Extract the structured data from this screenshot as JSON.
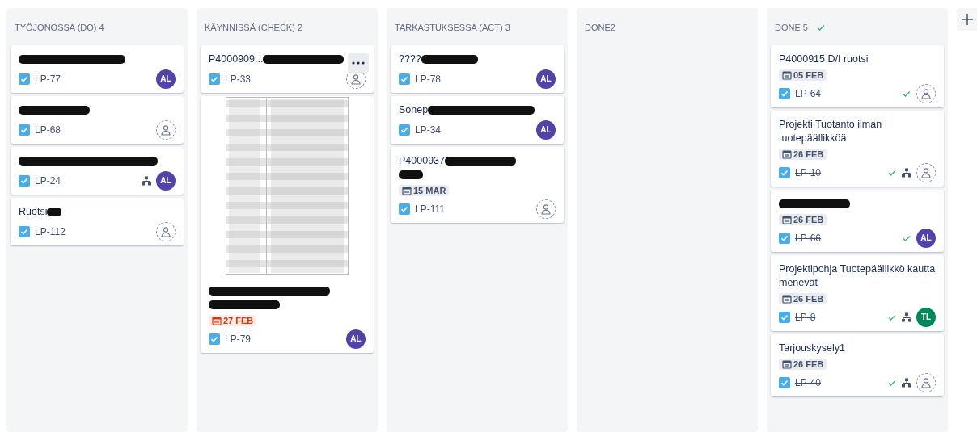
{
  "columns": [
    {
      "title": "TYÖJONOSSA (DO) 4",
      "done": false,
      "cards": [
        {
          "redactions": [
            {
              "kind": "wide"
            }
          ],
          "key": "LP-77",
          "resolved": false,
          "assignee": {
            "kind": "initials",
            "initials": "AL",
            "color": "#5243aa"
          }
        },
        {
          "redactions": [
            {
              "kind": "medium"
            }
          ],
          "key": "LP-68",
          "resolved": false,
          "assignee": {
            "kind": "unassigned"
          }
        },
        {
          "redactions": [
            {
              "kind": "full"
            }
          ],
          "key": "LP-24",
          "resolved": false,
          "has_children": true,
          "assignee": {
            "kind": "initials",
            "initials": "AL",
            "color": "#5243aa"
          }
        },
        {
          "title": "Ruotsi",
          "redactions": [
            {
              "kind": "tiny"
            }
          ],
          "key": "LP-112",
          "resolved": false,
          "assignee": {
            "kind": "unassigned"
          }
        }
      ]
    },
    {
      "title": "KÄYNNISSÄ (CHECK) 2",
      "done": false,
      "cards": [
        {
          "title": "P4000909...",
          "redactions": [
            {
              "kind": "inline"
            }
          ],
          "more_menu": true,
          "key": "LP-33",
          "resolved": false,
          "assignee": {
            "kind": "unassigned"
          }
        },
        {
          "attachment": {
            "kind": "picture"
          },
          "redactions": [
            {
              "kind": "long"
            },
            {
              "kind": "medium"
            }
          ],
          "due": {
            "text": "27 FEB",
            "overdue": true
          },
          "key": "LP-79",
          "resolved": false,
          "assignee": {
            "kind": "initials",
            "initials": "AL",
            "color": "#5243aa"
          }
        }
      ]
    },
    {
      "title": "TARKASTUKSESSA (ACT) 3",
      "done": false,
      "cards": [
        {
          "title": "????",
          "redactions": [
            {
              "kind": "short"
            }
          ],
          "key": "LP-78",
          "resolved": false,
          "assignee": {
            "kind": "initials",
            "initials": "AL",
            "color": "#5243aa"
          }
        },
        {
          "title": "Sonep",
          "redactions": [
            {
              "kind": "wide"
            }
          ],
          "key": "LP-34",
          "resolved": false,
          "assignee": {
            "kind": "initials",
            "initials": "AL",
            "color": "#5243aa"
          }
        },
        {
          "title": "P4000937",
          "redactions": [
            {
              "kind": "medium"
            },
            {
              "kind": "small"
            }
          ],
          "due": {
            "text": "15 MAR",
            "overdue": false
          },
          "key": "LP-111",
          "resolved": false,
          "assignee": {
            "kind": "unassigned"
          }
        }
      ]
    },
    {
      "title": "DONE2",
      "done": false
    },
    {
      "title": "DONE 5",
      "done": true,
      "cards": [
        {
          "title": "P4000915 D/I ruotsi",
          "due": {
            "text": "05 FEB",
            "overdue": false
          },
          "key": "LP-64",
          "resolved": true,
          "assignee": {
            "kind": "unassigned"
          }
        },
        {
          "title": "Projekti Tuotanto ilman tuotepäällikköä",
          "due": {
            "text": "26 FEB",
            "overdue": false
          },
          "key": "LP-10",
          "resolved": true,
          "has_children": true,
          "assignee": {
            "kind": "unassigned"
          }
        },
        {
          "redactions": [
            {
              "kind": "medium"
            }
          ],
          "due": {
            "text": "26 FEB",
            "overdue": false
          },
          "key": "LP-66",
          "resolved": true,
          "assignee": {
            "kind": "initials",
            "initials": "AL",
            "color": "#5243aa"
          }
        },
        {
          "title": "Projektipohja Tuotepäällikkö kautta menevät",
          "due": {
            "text": "26 FEB",
            "overdue": false
          },
          "key": "LP-8",
          "resolved": true,
          "has_children": true,
          "assignee": {
            "kind": "initials",
            "initials": "TL",
            "color": "#00875a"
          }
        },
        {
          "title": "Tarjouskysely1",
          "due": {
            "text": "26 FEB",
            "overdue": false
          },
          "key": "LP-40",
          "resolved": true,
          "has_children": true,
          "assignee": {
            "kind": "unassigned"
          }
        }
      ]
    }
  ]
}
